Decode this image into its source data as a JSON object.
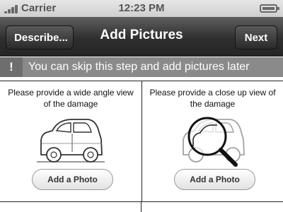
{
  "status_bar": {
    "carrier": "Carrier",
    "time": "12:23 PM"
  },
  "nav": {
    "back_label": "Describe...",
    "title": "Add Pictures",
    "next_label": "Next"
  },
  "notice": {
    "icon_glyph": "!",
    "text": "You can skip this step and add pictures later"
  },
  "panels": [
    {
      "instruction": "Please provide a wide angle view of the damage",
      "icon": "car-icon",
      "button_label": "Add a Photo"
    },
    {
      "instruction": "Please provide a close up view of the damage",
      "icon": "magnifier-car-icon",
      "button_label": "Add a Photo"
    }
  ]
}
